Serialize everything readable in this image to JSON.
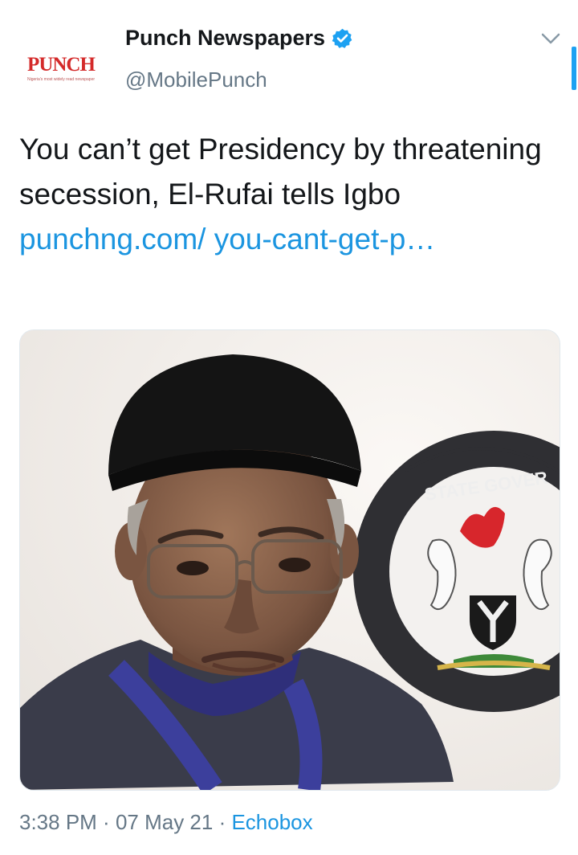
{
  "account": {
    "display_name": "Punch Newspapers",
    "handle": "@MobilePunch",
    "avatar_logo_text": "PUNCH",
    "avatar_tagline": "Nigeria's most widely read newspaper",
    "verified": true
  },
  "tweet": {
    "text": "You can’t get Presidency by threatening secession, El-Rufai tells Igbo ",
    "link_text": "punchng.com/ you-cant-get-p…"
  },
  "media": {
    "seal_text": "STATE GOVER"
  },
  "meta": {
    "time": "3:38 PM",
    "separator1": " · ",
    "date": "07 May 21",
    "separator2": " · ",
    "source": "Echobox"
  },
  "colors": {
    "link": "#1b95e0",
    "verified": "#1da1f2",
    "secondary_text": "#657786",
    "brand_red": "#d42a2a"
  },
  "icons": {
    "verified": "verified-badge-icon",
    "more": "chevron-down-icon"
  }
}
